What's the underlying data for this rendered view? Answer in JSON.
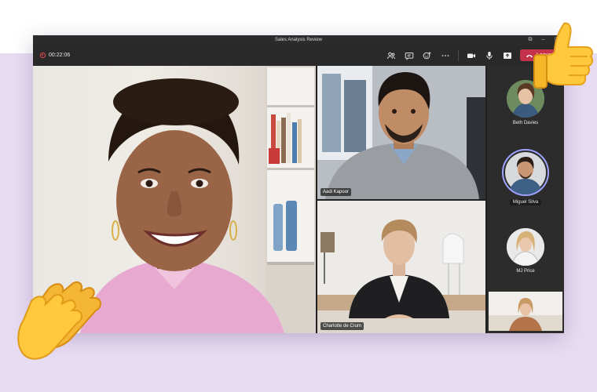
{
  "window": {
    "title": "Sales Analysis Review",
    "controls": [
      "⧉",
      "–",
      "▢"
    ]
  },
  "toolbar": {
    "timer": "00:22:06",
    "leave_label": "Leave",
    "icons": [
      "people-icon",
      "chat-icon",
      "reactions-icon",
      "more-icon",
      "camera-icon",
      "mic-icon",
      "share-icon"
    ]
  },
  "participants": {
    "main": {
      "name": ""
    },
    "top_right": {
      "name": "Aadi Kapoor"
    },
    "bottom_right": {
      "name": "Charlotte de Crum"
    },
    "side": [
      {
        "name": "Beth Davies"
      },
      {
        "name": "Miguel Silva",
        "active_speaker": true
      },
      {
        "name": "MJ Price"
      }
    ],
    "self_view": {
      "name": ""
    }
  },
  "colors": {
    "accent_leave": "#c4314b",
    "active_ring": "#9ea2ff",
    "band": "#e8dcf3"
  },
  "decorations": [
    "thumbs-up-emoji",
    "clapping-hands-emoji"
  ]
}
